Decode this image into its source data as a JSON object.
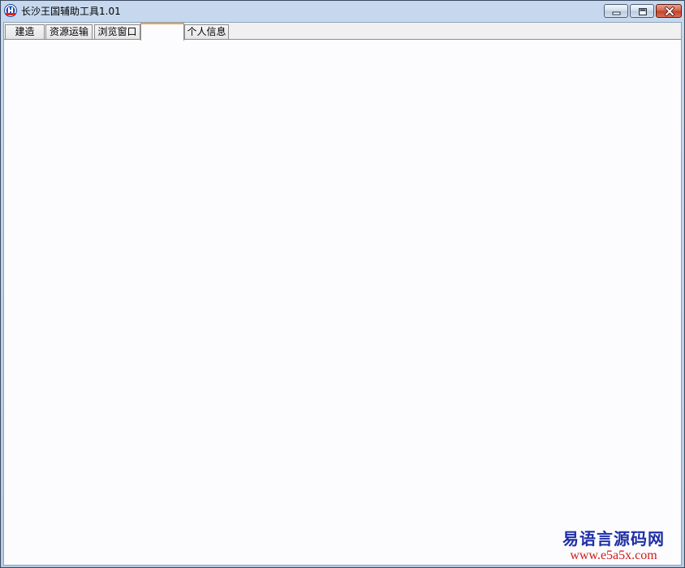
{
  "window": {
    "title": "长沙王国辅助工具1.01",
    "icon": "app-logo-icon"
  },
  "tabs": [
    {
      "label": "建造",
      "selected": false
    },
    {
      "label": "资源运输",
      "selected": false
    },
    {
      "label": "浏览窗口",
      "selected": false
    },
    {
      "label": "",
      "selected": true
    },
    {
      "label": "个人信息",
      "selected": false
    }
  ],
  "watermark": {
    "name": "易语言源码网",
    "url": "www.e5a5x.com"
  },
  "colors": {
    "selected_tab_accent": "#f2a43a",
    "watermark_name": "#1e2fa6",
    "watermark_url": "#d11a1a"
  }
}
